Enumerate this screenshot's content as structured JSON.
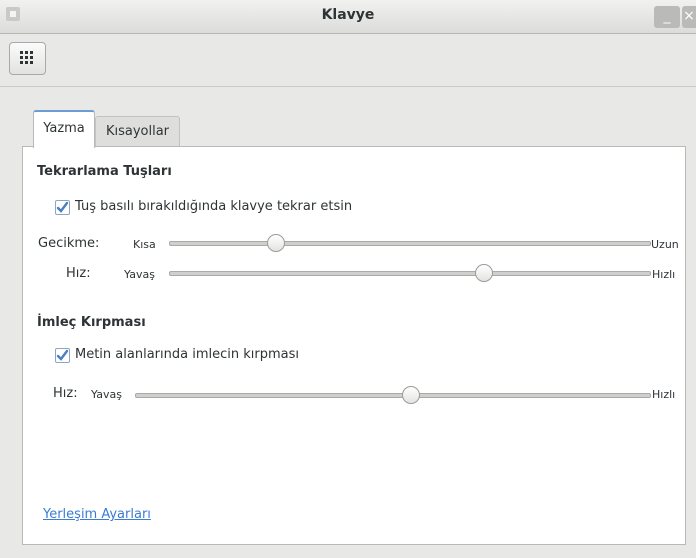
{
  "window": {
    "title": "Klavye"
  },
  "tabs": [
    {
      "label": "Yazma",
      "active": true
    },
    {
      "label": "Kısayollar",
      "active": false
    }
  ],
  "repeat_keys": {
    "heading": "Tekrarlama Tuşları",
    "checkbox_label": "Tuş basılı bırakıldığında klavye tekrar etsin",
    "checked": true,
    "delay": {
      "label": "Gecikme:",
      "min_label": "Kısa",
      "max_label": "Uzun",
      "value": 0.21
    },
    "speed": {
      "label": "Hız:",
      "min_label": "Yavaş",
      "max_label": "Hızlı",
      "value": 0.66
    }
  },
  "cursor_blink": {
    "heading": "İmleç Kırpması",
    "checkbox_label": "Metin alanlarında imlecin kırpması",
    "checked": true,
    "speed": {
      "label": "Hız:",
      "min_label": "Yavaş",
      "max_label": "Hızlı",
      "value": 0.54
    }
  },
  "footer": {
    "link_label": "Yerleşim Ayarları"
  },
  "colors": {
    "accent": "#6d9bd3",
    "link": "#3a7bd5",
    "checkmark": "#4a7fc1"
  },
  "icons": {
    "toolbar_button": "grid-icon",
    "window_menu": "window-menu-icon",
    "minimize": "minimize-icon",
    "close": "close-icon"
  }
}
